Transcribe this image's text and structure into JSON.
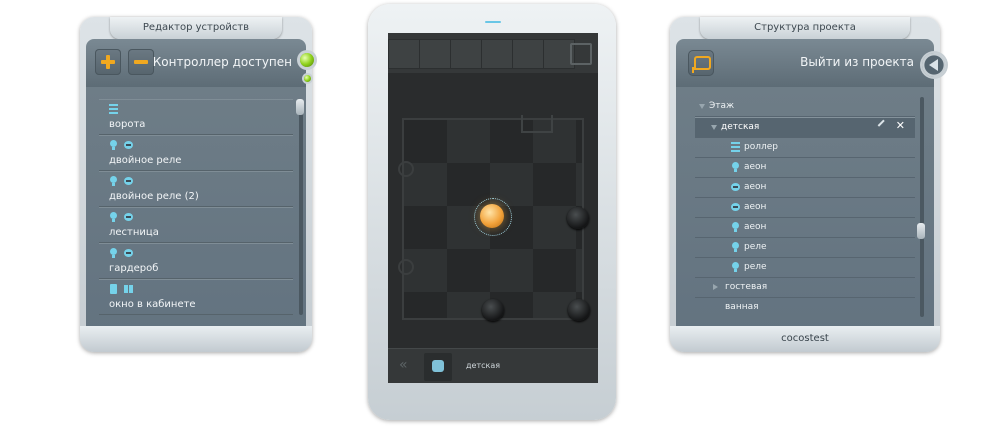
{
  "device_editor": {
    "title": "Редактор устройств",
    "status": "Контроллер доступен",
    "devices": [
      {
        "label": "ворота",
        "icons": [
          "bars-icon"
        ]
      },
      {
        "label": "двойное реле",
        "icons": [
          "bulb-icon",
          "dual-relay-icon"
        ]
      },
      {
        "label": "двойное реле (2)",
        "icons": [
          "bulb-icon",
          "dual-relay-icon"
        ]
      },
      {
        "label": "лестница",
        "icons": [
          "bulb-icon",
          "dual-relay-icon"
        ]
      },
      {
        "label": "гардероб",
        "icons": [
          "bulb-icon",
          "dual-relay-icon"
        ]
      },
      {
        "label": "окно в кабинете",
        "icons": [
          "door-icon",
          "grid-icon"
        ]
      }
    ]
  },
  "room_view": {
    "room_label": "детская",
    "back_glyph": "«"
  },
  "project_structure": {
    "title": "Структура проекта",
    "exit_label": "Выйти из проекта",
    "floor": "Этаж",
    "rooms": [
      {
        "label": "детская",
        "expanded": true,
        "selected": true
      },
      {
        "label": "гостевая",
        "expanded": false
      },
      {
        "label": "ванная",
        "expanded": false
      }
    ],
    "devices": [
      {
        "label": "роллер",
        "icon": "bars-icon"
      },
      {
        "label": "аеон",
        "icon": "bulb-icon"
      },
      {
        "label": "аеон",
        "icon": "dual-relay-icon"
      },
      {
        "label": "аеон",
        "icon": "dual-relay-icon"
      },
      {
        "label": "аеон",
        "icon": "bulb-icon"
      },
      {
        "label": "реле",
        "icon": "bulb-icon"
      },
      {
        "label": "реле",
        "icon": "bulb-icon"
      }
    ],
    "close_glyph": "✕",
    "footer": "cocostest"
  },
  "colors": {
    "accent": "#f0a820",
    "icon_blue": "#75d2ea",
    "led_green": "#8fd21c",
    "lamp": "#f2a23a"
  }
}
